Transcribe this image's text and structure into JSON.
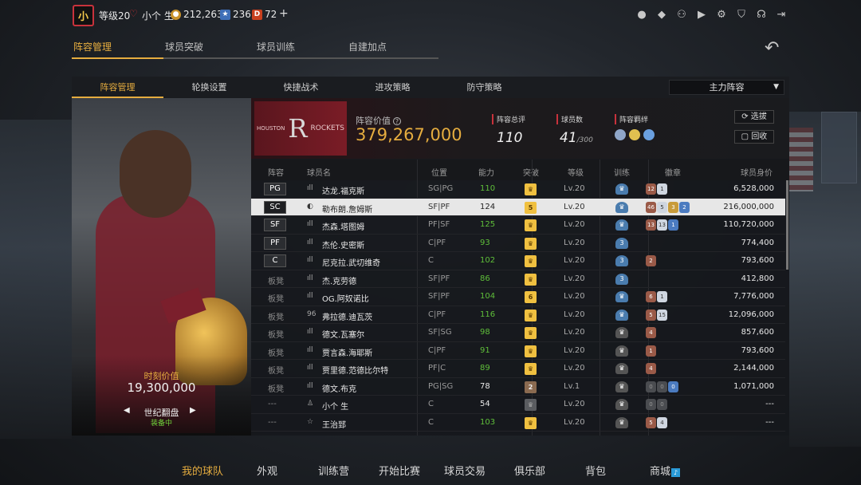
{
  "header": {
    "level": "等级20",
    "username": "小个 生",
    "coins": "212,263",
    "stars": "236",
    "tickets": "72",
    "plus": "+",
    "avatar_text": "小"
  },
  "main_tabs": [
    {
      "label": "阵容管理",
      "active": true
    },
    {
      "label": "球员突破",
      "active": false
    },
    {
      "label": "球员训练",
      "active": false
    },
    {
      "label": "自建加点",
      "active": false
    }
  ],
  "sub_tabs": [
    {
      "label": "阵容管理",
      "active": true
    },
    {
      "label": "轮换设置",
      "active": false
    },
    {
      "label": "快捷战术",
      "active": false
    },
    {
      "label": "进攻策略",
      "active": false
    },
    {
      "label": "防守策略",
      "active": false
    }
  ],
  "lineup_select": "主力阵容",
  "card": {
    "value_label": "时刻价值",
    "value": "19,300,000",
    "name": "世纪翻盘",
    "status": "装备中"
  },
  "team": {
    "logo_left": "HOUSTON",
    "logo_right": "ROCKETS",
    "value_label": "阵容价值",
    "value": "379,267,000",
    "overall_label": "阵容总评",
    "overall": "110",
    "count_label": "球员数",
    "count": "41",
    "count_max": "/300",
    "bond_label": "阵容羁绊",
    "btn_select": "选拔",
    "btn_recycle": "回收"
  },
  "columns": [
    "阵容",
    "球员名",
    "位置",
    "能力",
    "突破",
    "等级",
    "训练",
    "徽章",
    "球员身价"
  ],
  "players": [
    {
      "slot": "PG",
      "bench": false,
      "name": "达龙.福克斯",
      "pos": "SG|PG",
      "ability": "110",
      "green": true,
      "break": "",
      "break_style": "gold",
      "level": "Lv.20",
      "train": "",
      "train_style": "blue",
      "medals": [
        [
          "12",
          "bronze"
        ],
        [
          "1",
          "white"
        ]
      ],
      "value": "6,528,000",
      "selected": false,
      "icon": "ıll"
    },
    {
      "slot": "SC",
      "bench": false,
      "name": "勒布朗.詹姆斯",
      "pos": "SF|PF",
      "ability": "124",
      "green": false,
      "break": "5",
      "break_style": "gold",
      "level": "Lv.20",
      "train": "",
      "train_style": "blue",
      "medals": [
        [
          "46",
          "bronze"
        ],
        [
          "5",
          "white"
        ],
        [
          "3",
          "gold"
        ],
        [
          "2",
          "blue"
        ]
      ],
      "value": "216,000,000",
      "selected": true,
      "icon": "◐"
    },
    {
      "slot": "SF",
      "bench": false,
      "name": "杰森.塔图姆",
      "pos": "PF|SF",
      "ability": "125",
      "green": true,
      "break": "",
      "break_style": "gold",
      "level": "Lv.20",
      "train": "",
      "train_style": "blue",
      "medals": [
        [
          "13",
          "bronze"
        ],
        [
          "13",
          "white"
        ],
        [
          "1",
          "blue"
        ]
      ],
      "value": "110,720,000",
      "selected": false,
      "icon": "ıll"
    },
    {
      "slot": "PF",
      "bench": false,
      "name": "杰伦.史密斯",
      "pos": "C|PF",
      "ability": "93",
      "green": true,
      "break": "",
      "break_style": "gold",
      "level": "Lv.20",
      "train": "3",
      "train_style": "blue",
      "medals": [],
      "value": "774,400",
      "selected": false,
      "icon": "ıll"
    },
    {
      "slot": "C",
      "bench": false,
      "name": "尼克拉.武切维奇",
      "pos": "C",
      "ability": "102",
      "green": true,
      "break": "",
      "break_style": "gold",
      "level": "Lv.20",
      "train": "3",
      "train_style": "blue",
      "medals": [
        [
          "2",
          "bronze"
        ]
      ],
      "value": "793,600",
      "selected": false,
      "icon": "ıll"
    },
    {
      "slot": "板凳",
      "bench": true,
      "name": "杰.克劳德",
      "pos": "SF|PF",
      "ability": "86",
      "green": true,
      "break": "",
      "break_style": "gold",
      "level": "Lv.20",
      "train": "3",
      "train_style": "blue",
      "medals": [],
      "value": "412,800",
      "selected": false,
      "icon": "ıll"
    },
    {
      "slot": "板凳",
      "bench": true,
      "name": "OG.阿奴诺比",
      "pos": "SF|PF",
      "ability": "104",
      "green": true,
      "break": "6",
      "break_style": "gold",
      "level": "Lv.20",
      "train": "",
      "train_style": "blue",
      "medals": [
        [
          "6",
          "bronze"
        ],
        [
          "1",
          "white"
        ]
      ],
      "value": "7,776,000",
      "selected": false,
      "icon": "ıll"
    },
    {
      "slot": "板凳",
      "bench": true,
      "name": "弗拉德.迪瓦茨",
      "pos": "C|PF",
      "ability": "116",
      "green": true,
      "break": "",
      "break_style": "gold",
      "level": "Lv.20",
      "train": "",
      "train_style": "blue",
      "medals": [
        [
          "5",
          "bronze"
        ],
        [
          "15",
          "white"
        ]
      ],
      "value": "12,096,000",
      "selected": false,
      "icon": "96"
    },
    {
      "slot": "板凳",
      "bench": true,
      "name": "德文.瓦塞尔",
      "pos": "SF|SG",
      "ability": "98",
      "green": true,
      "break": "",
      "break_style": "gold",
      "level": "Lv.20",
      "train": "",
      "train_style": "dark",
      "medals": [
        [
          "4",
          "bronze"
        ]
      ],
      "value": "857,600",
      "selected": false,
      "icon": "ıll"
    },
    {
      "slot": "板凳",
      "bench": true,
      "name": "贾言森.海耶斯",
      "pos": "C|PF",
      "ability": "91",
      "green": true,
      "break": "",
      "break_style": "gold",
      "level": "Lv.20",
      "train": "",
      "train_style": "dark",
      "medals": [
        [
          "1",
          "bronze"
        ]
      ],
      "value": "793,600",
      "selected": false,
      "icon": "ıll"
    },
    {
      "slot": "板凳",
      "bench": true,
      "name": "贾里德.范德比尔特",
      "pos": "PF|C",
      "ability": "89",
      "green": true,
      "break": "",
      "break_style": "gold",
      "level": "Lv.20",
      "train": "",
      "train_style": "dark",
      "medals": [
        [
          "4",
          "bronze"
        ]
      ],
      "value": "2,144,000",
      "selected": false,
      "icon": "ıll"
    },
    {
      "slot": "板凳",
      "bench": true,
      "name": "德文.布克",
      "pos": "PG|SG",
      "ability": "78",
      "green": false,
      "break": "2",
      "break_style": "hex",
      "level": "Lv.1",
      "train": "",
      "train_style": "dark",
      "medals": [
        [
          "0",
          "grey"
        ],
        [
          "0",
          "grey"
        ],
        [
          "0",
          "blue"
        ]
      ],
      "value": "1,071,000",
      "selected": false,
      "icon": "ıll"
    },
    {
      "slot": "---",
      "bench": true,
      "name": "小个 生",
      "pos": "C",
      "ability": "54",
      "green": false,
      "break": "",
      "break_style": "grey",
      "level": "Lv.20",
      "train": "",
      "train_style": "dark",
      "medals": [
        [
          "0",
          "grey"
        ],
        [
          "0",
          "grey"
        ]
      ],
      "value": "---",
      "selected": false,
      "icon": "♙"
    },
    {
      "slot": "---",
      "bench": true,
      "name": "王治郅",
      "pos": "C",
      "ability": "103",
      "green": true,
      "break": "",
      "break_style": "gold",
      "level": "Lv.20",
      "train": "",
      "train_style": "dark",
      "medals": [
        [
          "5",
          "bronze"
        ],
        [
          "4",
          "white"
        ]
      ],
      "value": "---",
      "selected": false,
      "icon": "☆"
    }
  ],
  "bottom_nav": [
    {
      "label": "我的球队",
      "active": true
    },
    {
      "label": "外观",
      "active": false
    },
    {
      "label": "训练营",
      "active": false
    },
    {
      "label": "开始比赛",
      "active": false
    },
    {
      "label": "球员交易",
      "active": false
    },
    {
      "label": "俱乐部",
      "active": false
    },
    {
      "label": "背包",
      "active": false
    },
    {
      "label": "商城",
      "active": false
    }
  ],
  "colors": {
    "accent": "#e6ad3f",
    "green": "#5fbf3a",
    "red": "#c8323c"
  }
}
